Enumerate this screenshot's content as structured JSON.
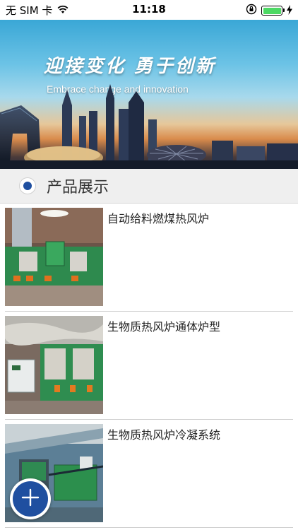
{
  "status": {
    "carrier": "无 SIM 卡",
    "time": "11:18"
  },
  "banner": {
    "title": "迎接变化    勇于创新",
    "subtitle": "Embrace change and innovation"
  },
  "section": {
    "title": "产品展示"
  },
  "products": [
    {
      "name": "自动给料燃煤热风炉"
    },
    {
      "name": "生物质热风炉通体炉型"
    },
    {
      "name": "生物质热风炉冷凝系统"
    }
  ],
  "colors": {
    "accent": "#1f4fa0",
    "battery": "#4cd964"
  },
  "icons": {
    "wifi": "wifi-icon",
    "orientation_lock": "orientation-lock-icon",
    "charging": "charging-icon",
    "fab": "plus-icon"
  }
}
